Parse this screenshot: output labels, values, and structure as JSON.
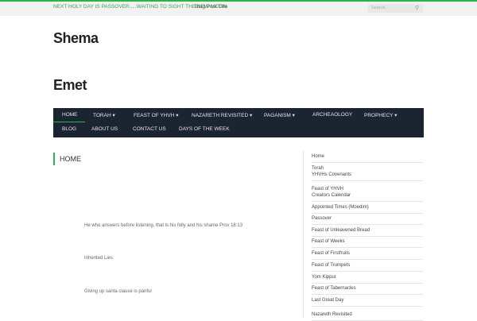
{
  "topbar": {
    "notice": "NEXT HOLY DAY IS PASSOVER.....WAITING TO SIGHT THE NEW MOON",
    "blog_post_title": "Blog Post Title",
    "search_placeholder": "Search..."
  },
  "site": {
    "title_line1": "Shema",
    "title_line2": "Emet"
  },
  "nav": [
    "HOME",
    "TORAH",
    "FEAST OF YHVH",
    "NAZARETH REVISITED",
    "PAGANISM",
    "ARCHEAOLOGY",
    "PROPHECY",
    "BLOG",
    "ABOUT US",
    "CONTACT US",
    "DAYS OF THE WEEK"
  ],
  "main": {
    "title": "HOME",
    "paragraphs": [
      "He who answers before listening, that is his folly and his shame Prov 18:13",
      "Inherited Lies",
      "Giving up santa clause is panful"
    ]
  },
  "sidebar": [
    [
      "Home"
    ],
    [
      "Torah",
      "YHVHs Covenants"
    ],
    [
      "Feast of YHVH",
      "Creators Calendar"
    ],
    [
      "Appointed Times (Moedim)"
    ],
    [
      "Passover"
    ],
    [
      "Feast of Unleavened Bread"
    ],
    [
      "Feast of Weeks"
    ],
    [
      "Feast of Firstfruits"
    ],
    [
      "Feast of Trumpets"
    ],
    [
      "Yom Kippur"
    ],
    [
      "Feast of Tabernacles"
    ],
    [
      "Last Great Day"
    ],
    [
      "Nazareth Revisited"
    ]
  ],
  "colors": {
    "accent": "#2db34a",
    "nav_bg": "#1b2532"
  }
}
